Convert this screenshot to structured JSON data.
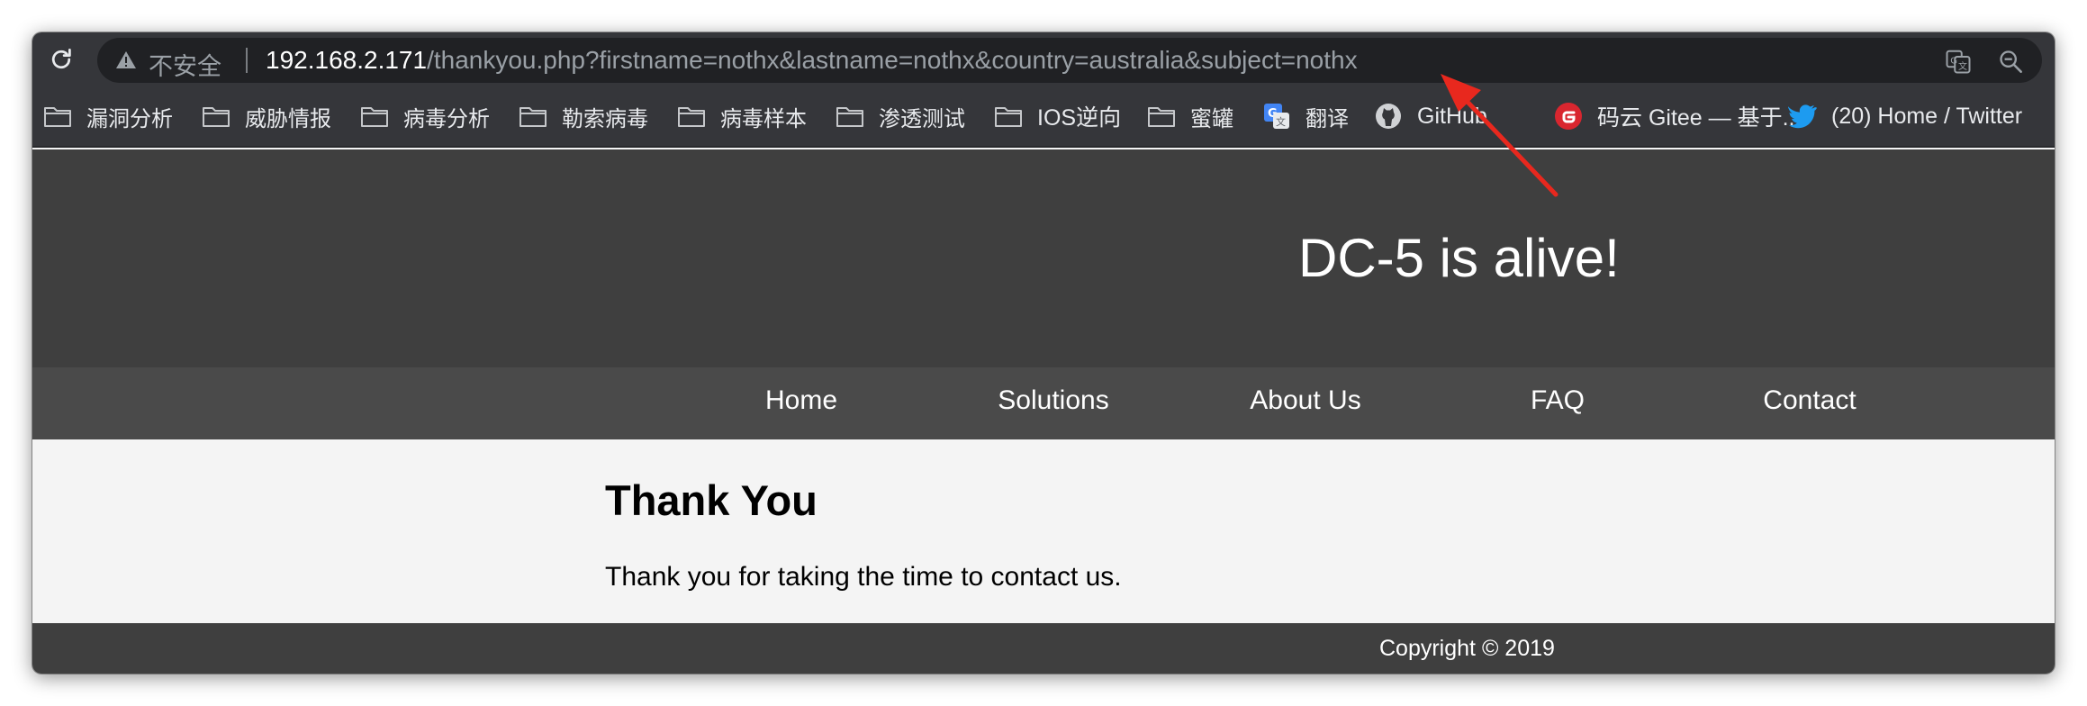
{
  "browser": {
    "security_label": "不安全",
    "url_host": "192.168.2.171",
    "url_path": "/thankyou.php?firstname=nothx&lastname=nothx&country=australia&subject=nothx",
    "bookmarks": [
      {
        "label": "漏洞分析",
        "icon": "folder-icon"
      },
      {
        "label": "威胁情报",
        "icon": "folder-icon"
      },
      {
        "label": "病毒分析",
        "icon": "folder-icon"
      },
      {
        "label": "勒索病毒",
        "icon": "folder-icon"
      },
      {
        "label": "病毒样本",
        "icon": "folder-icon"
      },
      {
        "label": "渗透测试",
        "icon": "folder-icon"
      },
      {
        "label": "IOS逆向",
        "icon": "folder-icon"
      },
      {
        "label": "蜜罐",
        "icon": "folder-icon"
      },
      {
        "label": "翻译",
        "icon": "google-translate-icon"
      },
      {
        "label": "GitHub",
        "icon": "github-icon"
      },
      {
        "label": "码云 Gitee — 基于...",
        "icon": "gitee-icon"
      },
      {
        "label": "(20) Home / Twitter",
        "icon": "twitter-icon"
      }
    ]
  },
  "site": {
    "title": "DC-5 is alive!",
    "nav": [
      "Home",
      "Solutions",
      "About Us",
      "FAQ",
      "Contact"
    ],
    "heading": "Thank You",
    "message": "Thank you for taking the time to contact us.",
    "copyright": "Copyright © 2019"
  },
  "colors": {
    "chrome_bg": "#35363a",
    "omnibox_bg": "#202124",
    "header_bg": "#3f3f3f",
    "nav_bg": "#4a4a4a",
    "content_bg": "#f4f4f4",
    "annotation_arrow": "#e8281e"
  }
}
